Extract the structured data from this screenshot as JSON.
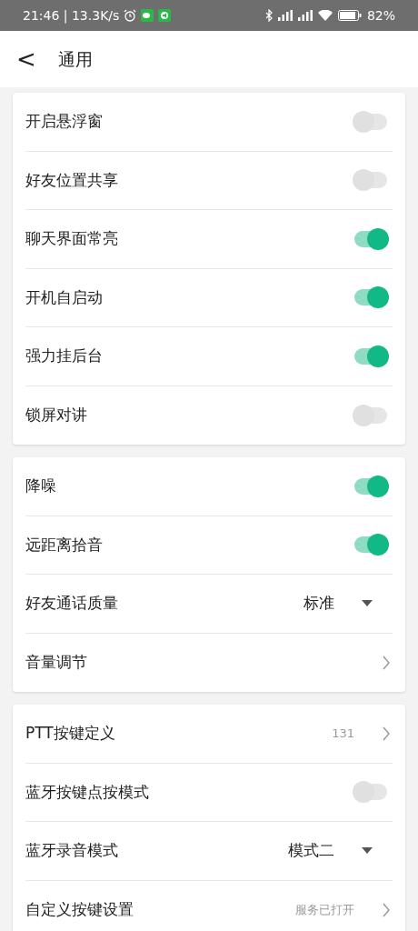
{
  "status_bar": {
    "time": "21:46 | 13.3K/s",
    "battery": "82%"
  },
  "header": {
    "back": "<",
    "title": "通用"
  },
  "groups": [
    {
      "rows": [
        {
          "kind": "toggle",
          "label": "开启悬浮窗",
          "on": false
        },
        {
          "kind": "toggle",
          "label": "好友位置共享",
          "on": false
        },
        {
          "kind": "toggle",
          "label": "聊天界面常亮",
          "on": true
        },
        {
          "kind": "toggle",
          "label": "开机自启动",
          "on": true
        },
        {
          "kind": "toggle",
          "label": "强力挂后台",
          "on": true
        },
        {
          "kind": "toggle",
          "label": "锁屏对讲",
          "on": false
        }
      ]
    },
    {
      "rows": [
        {
          "kind": "toggle",
          "label": "降噪",
          "on": true
        },
        {
          "kind": "toggle",
          "label": "远距离拾音",
          "on": true
        },
        {
          "kind": "dropdown",
          "label": "好友通话质量",
          "value": "标准"
        },
        {
          "kind": "link",
          "label": "音量调节"
        }
      ]
    },
    {
      "rows": [
        {
          "kind": "link",
          "label": "PTT按键定义",
          "value": "131"
        },
        {
          "kind": "toggle",
          "label": "蓝牙按键点按模式",
          "on": false
        },
        {
          "kind": "dropdown",
          "label": "蓝牙录音模式",
          "value": "模式二"
        },
        {
          "kind": "link",
          "label": "自定义按键设置",
          "value": "服务已打开"
        }
      ]
    }
  ]
}
